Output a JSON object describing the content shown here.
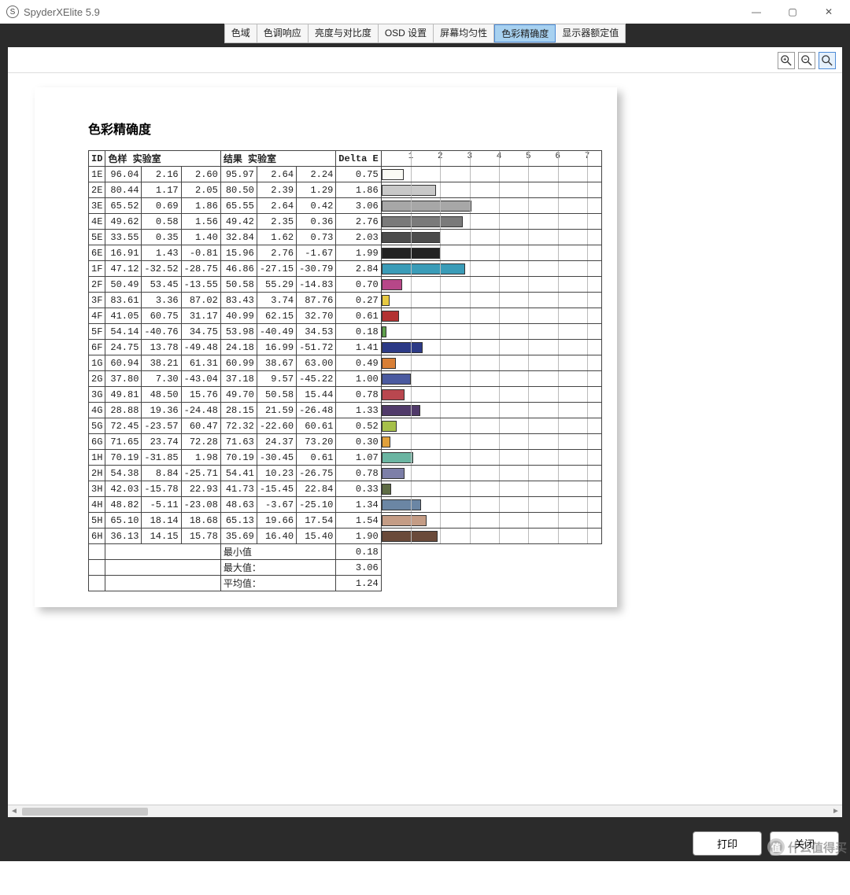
{
  "window": {
    "app_icon_letter": "S",
    "title": "SpyderXElite 5.9"
  },
  "tabs": [
    {
      "label": "色域",
      "active": false
    },
    {
      "label": "色调响应",
      "active": false
    },
    {
      "label": "亮度与对比度",
      "active": false
    },
    {
      "label": "OSD 设置",
      "active": false
    },
    {
      "label": "屏幕均匀性",
      "active": false
    },
    {
      "label": "色彩精确度",
      "active": true
    },
    {
      "label": "显示器额定值",
      "active": false
    }
  ],
  "section_title": "色彩精确度",
  "table": {
    "headers": {
      "id": "ID",
      "sample": "色样 实验室",
      "result": "结果 实验室",
      "delta": "Delta E"
    },
    "rows": [
      {
        "id": "1E",
        "s": [
          "96.04",
          "2.16",
          "2.60"
        ],
        "r": [
          "95.97",
          "2.64",
          "2.24"
        ],
        "d": "0.75",
        "color": "#fafaf4"
      },
      {
        "id": "2E",
        "s": [
          "80.44",
          "1.17",
          "2.05"
        ],
        "r": [
          "80.50",
          "2.39",
          "1.29"
        ],
        "d": "1.86",
        "color": "#c8c8c8"
      },
      {
        "id": "3E",
        "s": [
          "65.52",
          "0.69",
          "1.86"
        ],
        "r": [
          "65.55",
          "2.64",
          "0.42"
        ],
        "d": "3.06",
        "color": "#a7a7a7"
      },
      {
        "id": "4E",
        "s": [
          "49.62",
          "0.58",
          "1.56"
        ],
        "r": [
          "49.42",
          "2.35",
          "0.36"
        ],
        "d": "2.76",
        "color": "#7a7a7a"
      },
      {
        "id": "5E",
        "s": [
          "33.55",
          "0.35",
          "1.40"
        ],
        "r": [
          "32.84",
          "1.62",
          "0.73"
        ],
        "d": "2.03",
        "color": "#4c4c4c"
      },
      {
        "id": "6E",
        "s": [
          "16.91",
          "1.43",
          "-0.81"
        ],
        "r": [
          "15.96",
          "2.76",
          "-1.67"
        ],
        "d": "1.99",
        "color": "#222222"
      },
      {
        "id": "1F",
        "s": [
          "47.12",
          "-32.52",
          "-28.75"
        ],
        "r": [
          "46.86",
          "-27.15",
          "-30.79"
        ],
        "d": "2.84",
        "color": "#3a9cb8"
      },
      {
        "id": "2F",
        "s": [
          "50.49",
          "53.45",
          "-13.55"
        ],
        "r": [
          "50.58",
          "55.29",
          "-14.83"
        ],
        "d": "0.70",
        "color": "#b74788"
      },
      {
        "id": "3F",
        "s": [
          "83.61",
          "3.36",
          "87.02"
        ],
        "r": [
          "83.43",
          "3.74",
          "87.76"
        ],
        "d": "0.27",
        "color": "#e7c942"
      },
      {
        "id": "4F",
        "s": [
          "41.05",
          "60.75",
          "31.17"
        ],
        "r": [
          "40.99",
          "62.15",
          "32.70"
        ],
        "d": "0.61",
        "color": "#b33333"
      },
      {
        "id": "5F",
        "s": [
          "54.14",
          "-40.76",
          "34.75"
        ],
        "r": [
          "53.98",
          "-40.49",
          "34.53"
        ],
        "d": "0.18",
        "color": "#5ea04b"
      },
      {
        "id": "6F",
        "s": [
          "24.75",
          "13.78",
          "-49.48"
        ],
        "r": [
          "24.18",
          "16.99",
          "-51.72"
        ],
        "d": "1.41",
        "color": "#2c3a86"
      },
      {
        "id": "1G",
        "s": [
          "60.94",
          "38.21",
          "61.31"
        ],
        "r": [
          "60.99",
          "38.67",
          "63.00"
        ],
        "d": "0.49",
        "color": "#d87f36"
      },
      {
        "id": "2G",
        "s": [
          "37.80",
          "7.30",
          "-43.04"
        ],
        "r": [
          "37.18",
          "9.57",
          "-45.22"
        ],
        "d": "1.00",
        "color": "#4a5aa0"
      },
      {
        "id": "3G",
        "s": [
          "49.81",
          "48.50",
          "15.76"
        ],
        "r": [
          "49.70",
          "50.58",
          "15.44"
        ],
        "d": "0.78",
        "color": "#b9474f"
      },
      {
        "id": "4G",
        "s": [
          "28.88",
          "19.36",
          "-24.48"
        ],
        "r": [
          "28.15",
          "21.59",
          "-26.48"
        ],
        "d": "1.33",
        "color": "#503a6a"
      },
      {
        "id": "5G",
        "s": [
          "72.45",
          "-23.57",
          "60.47"
        ],
        "r": [
          "72.32",
          "-22.60",
          "60.61"
        ],
        "d": "0.52",
        "color": "#a6c04a"
      },
      {
        "id": "6G",
        "s": [
          "71.65",
          "23.74",
          "72.28"
        ],
        "r": [
          "71.63",
          "24.37",
          "73.20"
        ],
        "d": "0.30",
        "color": "#e0a03a"
      },
      {
        "id": "1H",
        "s": [
          "70.19",
          "-31.85",
          "1.98"
        ],
        "r": [
          "70.19",
          "-30.45",
          "0.61"
        ],
        "d": "1.07",
        "color": "#6bb5a2"
      },
      {
        "id": "2H",
        "s": [
          "54.38",
          "8.84",
          "-25.71"
        ],
        "r": [
          "54.41",
          "10.23",
          "-26.75"
        ],
        "d": "0.78",
        "color": "#7d7fa8"
      },
      {
        "id": "3H",
        "s": [
          "42.03",
          "-15.78",
          "22.93"
        ],
        "r": [
          "41.73",
          "-15.45",
          "22.84"
        ],
        "d": "0.33",
        "color": "#5f6d45"
      },
      {
        "id": "4H",
        "s": [
          "48.82",
          "-5.11",
          "-23.08"
        ],
        "r": [
          "48.63",
          "-3.67",
          "-25.10"
        ],
        "d": "1.34",
        "color": "#6b86a4"
      },
      {
        "id": "5H",
        "s": [
          "65.10",
          "18.14",
          "18.68"
        ],
        "r": [
          "65.13",
          "19.66",
          "17.54"
        ],
        "d": "1.54",
        "color": "#c49c85"
      },
      {
        "id": "6H",
        "s": [
          "36.13",
          "14.15",
          "15.78"
        ],
        "r": [
          "35.69",
          "16.40",
          "15.40"
        ],
        "d": "1.90",
        "color": "#6a4a3a"
      }
    ],
    "summary": [
      {
        "label": "最小值",
        "value": "0.18"
      },
      {
        "label": "最大值：",
        "value": "3.06"
      },
      {
        "label": "平均值：",
        "value": "1.24"
      }
    ]
  },
  "chart_data": {
    "type": "bar",
    "title": "Delta E",
    "xlabel": "",
    "ylabel": "",
    "xlim": [
      0,
      7.5
    ],
    "xticks": [
      1,
      2,
      3,
      4,
      5,
      6,
      7
    ],
    "categories": [
      "1E",
      "2E",
      "3E",
      "4E",
      "5E",
      "6E",
      "1F",
      "2F",
      "3F",
      "4F",
      "5F",
      "6F",
      "1G",
      "2G",
      "3G",
      "4G",
      "5G",
      "6G",
      "1H",
      "2H",
      "3H",
      "4H",
      "5H",
      "6H"
    ],
    "values": [
      0.75,
      1.86,
      3.06,
      2.76,
      2.03,
      1.99,
      2.84,
      0.7,
      0.27,
      0.61,
      0.18,
      1.41,
      0.49,
      1.0,
      0.78,
      1.33,
      0.52,
      0.3,
      1.07,
      0.78,
      0.33,
      1.34,
      1.54,
      1.9
    ]
  },
  "buttons": {
    "print": "打印",
    "close": "关闭"
  },
  "watermark": "什么值得买"
}
